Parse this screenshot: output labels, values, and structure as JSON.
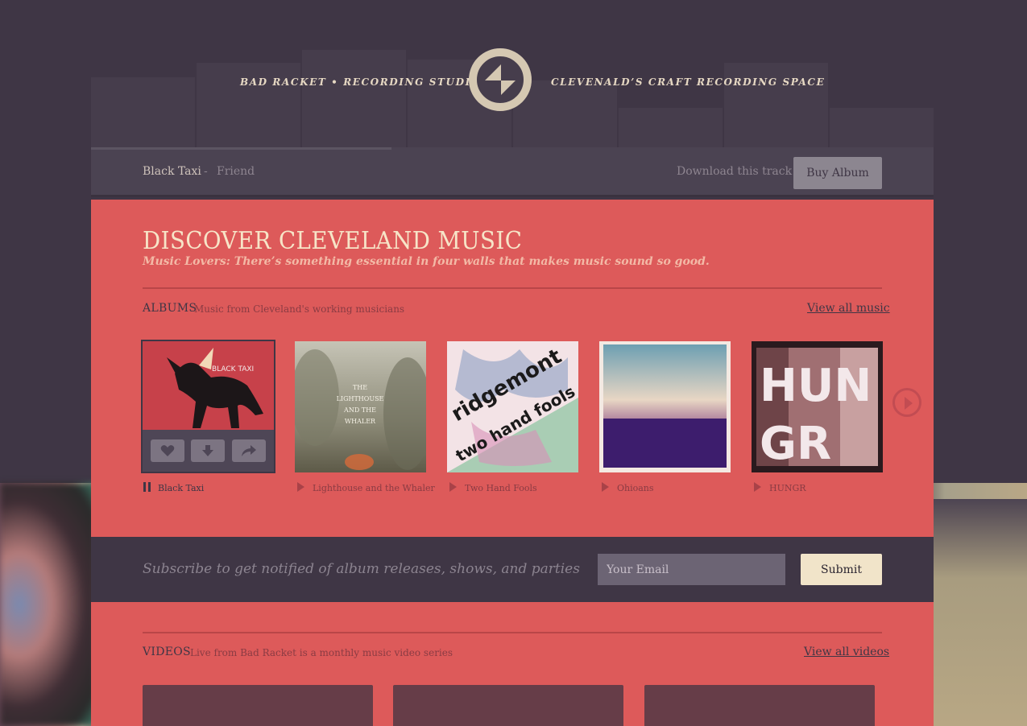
{
  "header": {
    "left_text": "BAD RACKET • RECORDING STUDIO",
    "right_text": "CLEVENALD’S CRAFT RECORDING SPACE",
    "logo_icon": "bad-racket-logo-icon"
  },
  "player": {
    "artist": "Black Taxi",
    "separator": "-",
    "song": "Friend",
    "download_label": "Download this track",
    "buy_label": "Buy Album"
  },
  "main": {
    "title": "DISCOVER CLEVELAND MUSIC",
    "tagline": "Music Lovers: There’s something essential in four walls that makes music sound so good."
  },
  "albums_section": {
    "title": "ALBUMS",
    "subtitle": "Music from Cleveland's working musicians",
    "view_all": "View all music",
    "items": [
      {
        "name": "Black Taxi",
        "playing": true,
        "art_text": "BLACK TAXI"
      },
      {
        "name": "Lighthouse and the Whaler",
        "playing": false,
        "art_text": "THE LIGHTHOUSE AND THE WHALER"
      },
      {
        "name": "Two Hand Fools",
        "playing": false,
        "art_text": "ridgemont two hand fools"
      },
      {
        "name": "Ohioans",
        "playing": false,
        "art_text": ""
      },
      {
        "name": "HUNGR",
        "playing": false,
        "art_text": "HUN GR"
      }
    ],
    "actions": [
      "heart-icon",
      "download-icon",
      "share-icon"
    ],
    "next_icon": "next-arrow-icon"
  },
  "subscribe": {
    "message": "Subscribe to get notified of album releases, shows, and parties",
    "email_placeholder": "Your Email",
    "submit_label": "Submit"
  },
  "videos_section": {
    "title": "VIDEOS",
    "subtitle": "Live from Bad Racket is a monthly music video series",
    "view_all": "View all videos"
  },
  "colors": {
    "background": "#3f3645",
    "accent_red": "#dd5a5a",
    "cream": "#f1e4c9"
  }
}
